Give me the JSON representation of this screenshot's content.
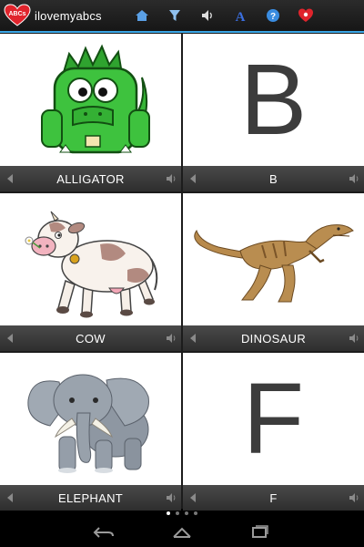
{
  "app": {
    "title": "ilovemyabcs",
    "logo_text": "ABCs"
  },
  "toolbar": {
    "icons": [
      "home-icon",
      "filter-icon",
      "speaker-icon",
      "font-icon",
      "help-icon",
      "heart-icon"
    ]
  },
  "cards": [
    {
      "label": "ALLIGATOR",
      "type": "image",
      "image": "green-alligator"
    },
    {
      "label": "B",
      "type": "letter",
      "letter": "B"
    },
    {
      "label": "COW",
      "type": "image",
      "image": "cow"
    },
    {
      "label": "DINOSAUR",
      "type": "image",
      "image": "dinosaur"
    },
    {
      "label": "ELEPHANT",
      "type": "image",
      "image": "elephant"
    },
    {
      "label": "F",
      "type": "letter",
      "letter": "F"
    }
  ],
  "pager": {
    "pages": 4,
    "active": 1
  },
  "colors": {
    "accent": "#3aa6e6",
    "bar": "#3a3a3a",
    "letter": "#3c3c3c"
  }
}
